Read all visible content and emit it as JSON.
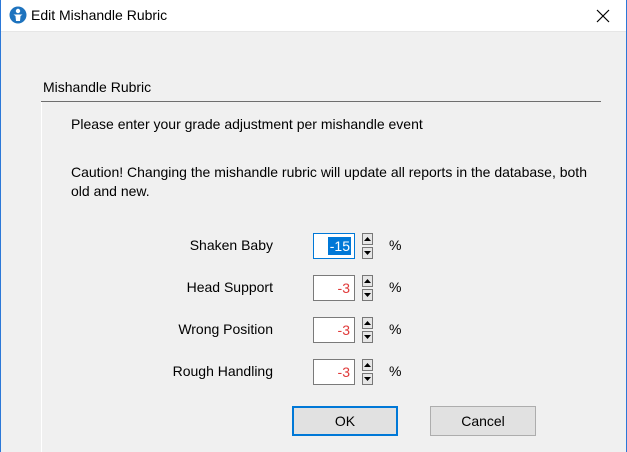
{
  "window": {
    "title": "Edit Mishandle Rubric"
  },
  "group": {
    "title": "Mishandle Rubric",
    "instruction": "Please enter your grade adjustment per mishandle event",
    "caution": "Caution! Changing the mishandle rubric will update all reports in the database, both old and new."
  },
  "rows": [
    {
      "label": "Shaken Baby",
      "value": "-15",
      "unit": "%"
    },
    {
      "label": "Head Support",
      "value": "-3",
      "unit": "%"
    },
    {
      "label": "Wrong Position",
      "value": "-3",
      "unit": "%"
    },
    {
      "label": "Rough Handling",
      "value": "-3",
      "unit": "%"
    }
  ],
  "buttons": {
    "ok": "OK",
    "cancel": "Cancel"
  },
  "colors": {
    "value_text": "#e03a3a",
    "accent": "#0078d7"
  }
}
